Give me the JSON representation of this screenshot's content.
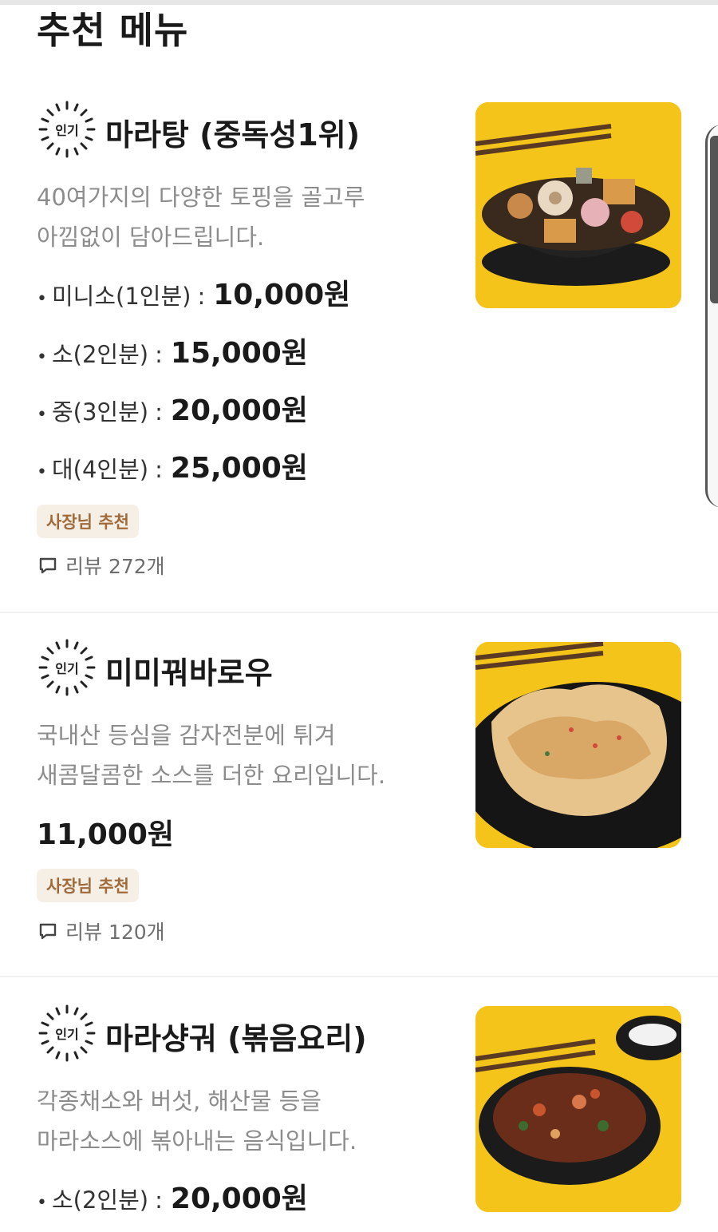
{
  "page": {
    "title": "추천 메뉴"
  },
  "items": [
    {
      "badge": "인기",
      "name": "마라탕 (중독성1위)",
      "desc_line1": "40여가지의 다양한 토핑을 골고루",
      "desc_line2": "아낌없이 담아드립니다.",
      "prices": [
        {
          "label": "미니소(1인분)",
          "amount": "10,000원"
        },
        {
          "label": "소(2인분)",
          "amount": "15,000원"
        },
        {
          "label": "중(3인분)",
          "amount": "20,000원"
        },
        {
          "label": "대(4인분)",
          "amount": "25,000원"
        }
      ],
      "tag": "사장님 추천",
      "review": "리뷰 272개"
    },
    {
      "badge": "인기",
      "name": "미미꿔바로우",
      "desc_line1": "국내산 등심을 감자전분에 튀겨",
      "desc_line2": "새콤달콤한 소스를 더한 요리입니다.",
      "price": "11,000원",
      "tag": "사장님 추천",
      "review": "리뷰 120개"
    },
    {
      "badge": "인기",
      "name": "마라샹궈 (볶음요리)",
      "desc_line1": "각종채소와 버섯, 해산물 등을",
      "desc_line2": "마라소스에 볶아내는 음식입니다.",
      "prices": [
        {
          "label": "소(2인분)",
          "amount": "20,000원"
        }
      ]
    }
  ],
  "icons": {
    "badge": "sunburst-badge-icon",
    "review": "speech-bubble-icon"
  },
  "colors": {
    "photo_bg": "#f5c41a",
    "tag_bg": "#f5efe6",
    "tag_text": "#a06a3b"
  }
}
